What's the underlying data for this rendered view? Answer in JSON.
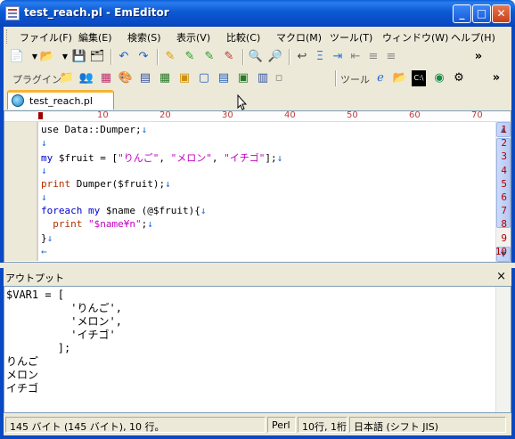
{
  "window": {
    "title": "test_reach.pl - EmEditor",
    "minimize": "_",
    "maximize": "□",
    "close": "✕"
  },
  "menu": {
    "items": [
      "ファイル(F)",
      "編集(E)",
      "検索(S)",
      "表示(V)",
      "比較(C)",
      "マクロ(M)",
      "ツール(T)",
      "ウィンドウ(W)",
      "ヘルプ(H)"
    ],
    "overflow": "»"
  },
  "toolbar2": {
    "plugin_label": "プラグイン",
    "tool_label": "ツール"
  },
  "tab": {
    "label": "test_reach.pl"
  },
  "ruler": {
    "marks": [
      "10",
      "20",
      "30",
      "40",
      "50",
      "60",
      "70"
    ]
  },
  "editor": {
    "lines": [
      {
        "no": "1",
        "html": "use Data::Dumper;<span class='nl'>↓</span>"
      },
      {
        "no": "2",
        "html": "<span class='nl'>↓</span>"
      },
      {
        "no": "3",
        "html": "<span class='kw'>my</span> $fruit = [<span class='str'>\"りんご\"</span>, <span class='str'>\"メロン\"</span>, <span class='str'>\"イチゴ\"</span>];<span class='nl'>↓</span>"
      },
      {
        "no": "4",
        "html": "<span class='nl'>↓</span>"
      },
      {
        "no": "5",
        "html": "<span class='fn'>print</span> Dumper($fruit);<span class='nl'>↓</span>"
      },
      {
        "no": "6",
        "html": "<span class='nl'>↓</span>"
      },
      {
        "no": "7",
        "html": "<span class='kw'>foreach</span> <span class='kw'>my</span> $name (@$fruit){<span class='nl'>↓</span>"
      },
      {
        "no": "8",
        "html": "  <span class='fn'>print</span> <span class='str'>\"$name¥n\"</span>;<span class='nl'>↓</span>"
      },
      {
        "no": "9",
        "html": "}<span class='nl'>↓</span>"
      },
      {
        "no": "10",
        "html": "<span class='nl'>←</span>"
      }
    ]
  },
  "output": {
    "title": "アウトプット",
    "close": "×",
    "lines": [
      "$VAR1 = [",
      "          'りんご',",
      "          'メロン',",
      "          'イチゴ'",
      "        ];",
      "りんご",
      "メロン",
      "イチゴ"
    ]
  },
  "status": {
    "size": "145 バイト (145 バイト), 10 行。",
    "mode": "Perl",
    "position": "10行, 1桁",
    "encoding": "日本語 (シフト JIS)"
  }
}
